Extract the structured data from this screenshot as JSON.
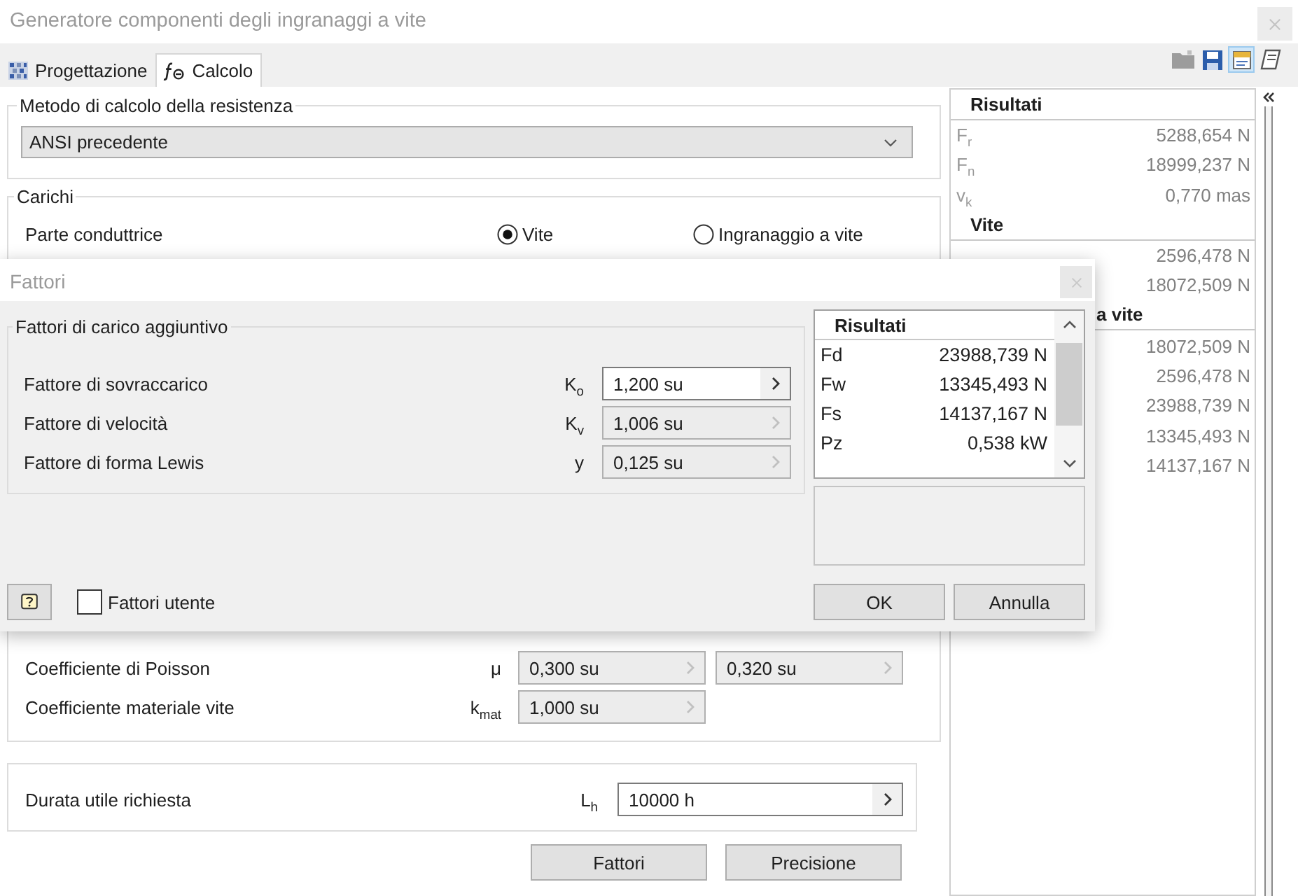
{
  "window": {
    "title": "Generatore componenti degli ingranaggi a vite"
  },
  "tabs": [
    {
      "label": "Progettazione",
      "selected": false
    },
    {
      "label": "Calcolo",
      "selected": true
    }
  ],
  "toolbar": [
    {
      "pressed": false
    },
    {
      "pressed": false
    },
    {
      "pressed": true
    },
    {
      "pressed": false
    }
  ],
  "strength_method": {
    "legend": "Metodo di calcolo della resistenza",
    "value": "ANSI precedente"
  },
  "loads": {
    "legend": "Carichi",
    "driving_part": {
      "label": "Parte conduttrice",
      "options": [
        {
          "label": "Vite",
          "selected": true
        },
        {
          "label": "Ingranaggio a vite",
          "selected": false
        }
      ]
    },
    "rows": [
      {
        "label": "Coefficiente di Poisson",
        "symbol": "μ",
        "fields": [
          {
            "value": "0,300 su",
            "disabled": true
          },
          {
            "value": "0,320 su",
            "disabled": true
          }
        ]
      },
      {
        "label": "Coefficiente materiale vite",
        "symbol": "k$_{mat}$",
        "fields": [
          {
            "value": "1,000 su",
            "disabled": true
          }
        ]
      }
    ]
  },
  "service_life": {
    "label": "Durata utile richiesta",
    "symbol": "L$_{h}$",
    "field": {
      "value": "10000 h",
      "disabled": false
    }
  },
  "buttons": [
    "Fattori",
    "Precisione"
  ],
  "results_panel": {
    "sections": [
      {
        "title": "Risultati",
        "rows": [
          {
            "symbol": "F$_{r}$",
            "value": "5288,654 N"
          },
          {
            "symbol": "F$_{n}$",
            "value": "18999,237 N"
          },
          {
            "symbol": "v$_{k}$",
            "value": "0,770 mas"
          }
        ]
      },
      {
        "title": "Vite",
        "rows": [
          {
            "value": "2596,478 N"
          },
          {
            "value": "18072,509 N"
          }
        ]
      },
      {
        "title": "a vite",
        "rows": [
          {
            "value": "18072,509 N"
          },
          {
            "value": "2596,478 N"
          },
          {
            "value": "23988,739 N"
          },
          {
            "value": "13345,493 N"
          },
          {
            "value": "14137,167 N"
          }
        ]
      }
    ]
  },
  "dialog": {
    "title": "Fattori",
    "group": {
      "legend": "Fattori di carico aggiuntivo",
      "rows": [
        {
          "label": "Fattore di sovraccarico",
          "symbol": "K$_{o}$",
          "value": "1,200 su",
          "disabled": false
        },
        {
          "label": "Fattore di velocità",
          "symbol": "K$_{v}$",
          "value": "1,006 su",
          "disabled": true
        },
        {
          "label": "Fattore di forma Lewis",
          "symbol": "y",
          "value": "0,125 su",
          "disabled": true
        }
      ]
    },
    "results": {
      "title": "Risultati",
      "rows": [
        {
          "name": "Fd",
          "value": "23988,739 N"
        },
        {
          "name": "Fw",
          "value": "13345,493 N"
        },
        {
          "name": "Fs",
          "value": "14137,167 N"
        },
        {
          "name": "Pz",
          "value": "0,538 kW"
        }
      ]
    },
    "user_factors": {
      "label": "Fattori utente",
      "checked": false
    },
    "buttons": [
      "OK",
      "Annulla"
    ]
  }
}
